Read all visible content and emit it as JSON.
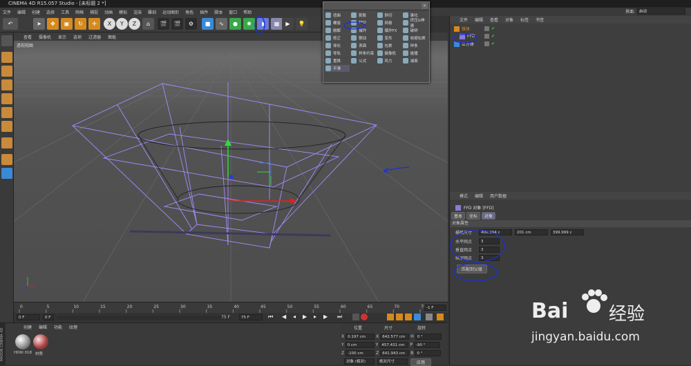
{
  "window": {
    "title": "CINEMA 4D R15.057 Studio - [未标题 2 *]"
  },
  "menu": [
    "文件",
    "编辑",
    "创建",
    "选择",
    "工具",
    "网格",
    "捕捉",
    "动画",
    "模拟",
    "渲染",
    "雕刻",
    "运动图形",
    "角色",
    "插件",
    "脚本",
    "窗口",
    "帮助"
  ],
  "layout": {
    "label": "界面:",
    "value": "启动"
  },
  "toolbar": {
    "axis_x": "X",
    "axis_y": "Y",
    "axis_z": "Z"
  },
  "viewport": {
    "menu": [
      "查看",
      "摄像机",
      "显示",
      "选项",
      "过滤器",
      "面板"
    ],
    "label": "透视视图"
  },
  "deformer_popup": {
    "items": [
      "扭曲",
      "膨胀",
      "斜切",
      "锥化",
      "螺旋",
      "FFD",
      "网格",
      "挤压&伸展",
      "融解",
      "爆炸",
      "爆炸FX",
      "破碎",
      "修正",
      "颤动",
      "变形",
      "收缩包裹",
      "球化",
      "表面",
      "包裹",
      "样条",
      "导轨",
      "样条约束",
      "摄像机",
      "碰撞",
      "置换",
      "公式",
      "风力",
      "减面",
      "平滑"
    ]
  },
  "object_manager": {
    "tabs": [
      "文件",
      "编辑",
      "查看",
      "对象",
      "标签",
      "书签"
    ],
    "objects": [
      {
        "name": "锥体"
      },
      {
        "name": "FFD"
      },
      {
        "name": "立方体"
      }
    ]
  },
  "attributes": {
    "tabs": [
      "模式",
      "编辑",
      "用户数据"
    ],
    "object_title": "FFD 对象 [FFD]",
    "subtabs": [
      "基本",
      "坐标",
      "对象"
    ],
    "section": "对象属性",
    "grid_size_label": "栅格尺寸",
    "grid_size": [
      "400.394 c",
      "201 cm",
      "399.999 c"
    ],
    "h_grid_label": "水平网点",
    "h_grid": "3",
    "v_grid_label": "垂直网点",
    "v_grid": "3",
    "d_grid_label": "纵深网点",
    "d_grid": "3",
    "fit_button": "匹配到父级"
  },
  "timeline": {
    "ticks": [
      "0",
      "5",
      "10",
      "15",
      "20",
      "25",
      "30",
      "35",
      "40",
      "45",
      "50",
      "55",
      "60",
      "65",
      "70",
      "75"
    ],
    "current_frame": "0 F",
    "start": "0 F",
    "end": "75 F",
    "end2": "75 F",
    "frame_right": "-1 F"
  },
  "material_manager": {
    "tabs": [
      "创建",
      "编辑",
      "功能",
      "纹理"
    ],
    "materials": [
      "HDRI 018",
      "材质"
    ]
  },
  "coordinates": {
    "headers": [
      "位置",
      "尺寸",
      "旋转"
    ],
    "rows": [
      {
        "axis": "X",
        "pos": "0.197 cm",
        "size_axis": "X",
        "size": "642.577 cm",
        "rot_axis": "H",
        "rot": "0 °"
      },
      {
        "axis": "Y",
        "pos": "0 cm",
        "size_axis": "Y",
        "size": "457.431 cm",
        "rot_axis": "P",
        "rot": "-90 °"
      },
      {
        "axis": "Z",
        "pos": "-100 cm",
        "size_axis": "Z",
        "size": "641.943 cm",
        "rot_axis": "B",
        "rot": "0 °"
      }
    ],
    "mode": "对象 (相对)",
    "size_mode": "绝对尺寸",
    "apply": "应用"
  },
  "watermark": {
    "brand": "Bai",
    "brand2": "经验",
    "url": "jingyan.baidu.com"
  },
  "maxon": "MAXON CINEMA 4D",
  "colors": {
    "annotation": "#1c2fd6",
    "wireframe": "#a58cff",
    "accent": "#c98a3a"
  }
}
